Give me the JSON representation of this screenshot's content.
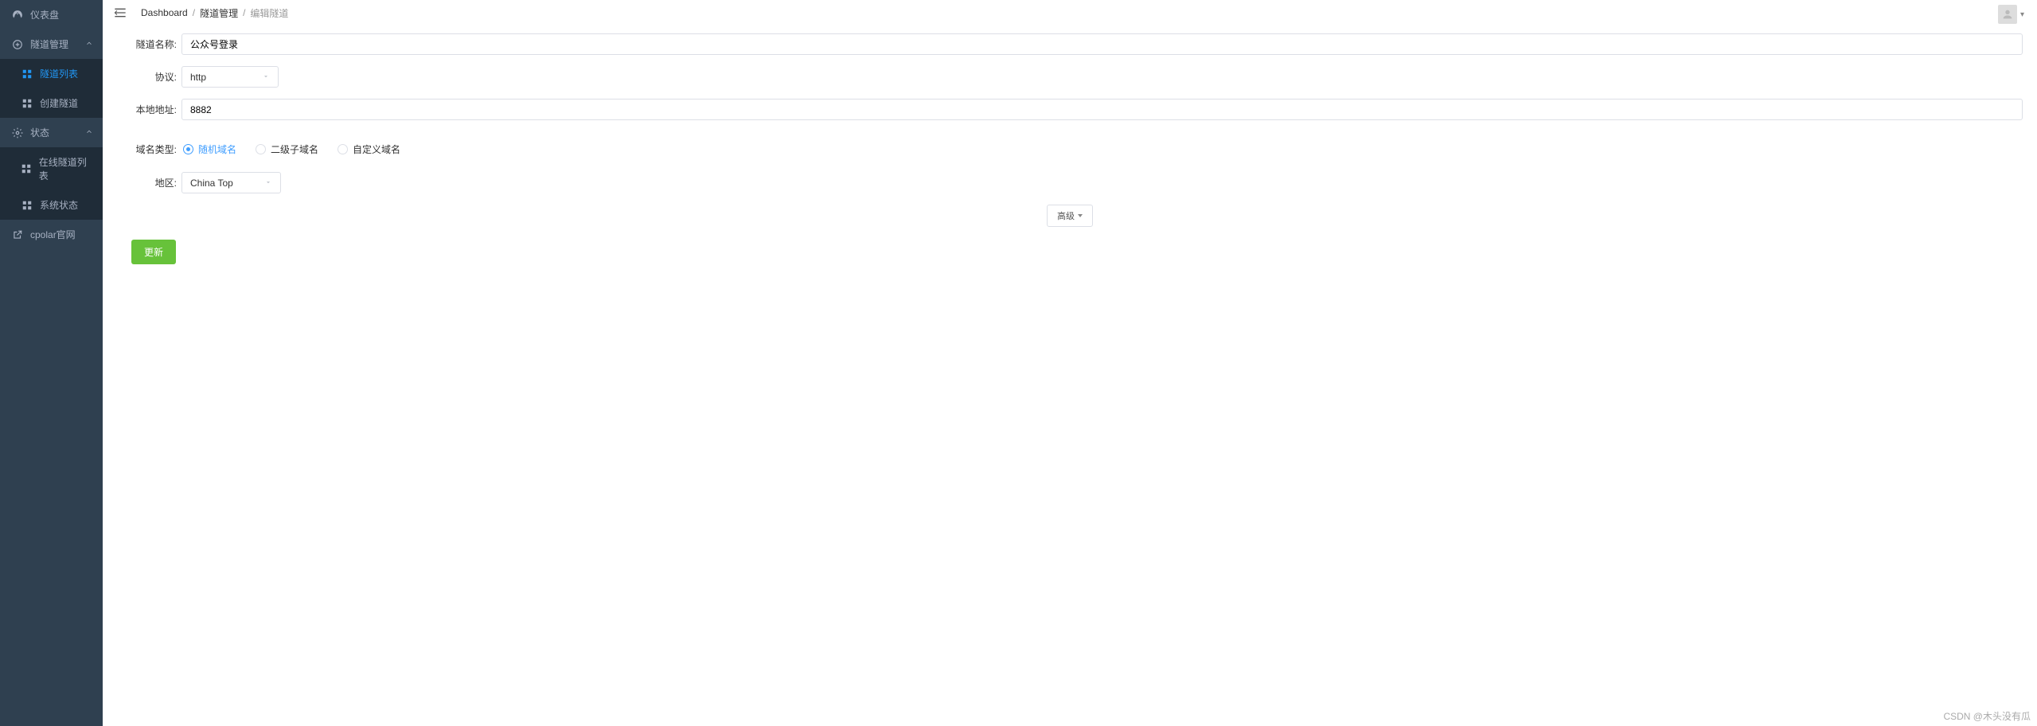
{
  "sidebar": {
    "items": [
      {
        "label": "仪表盘",
        "icon": "dashboard"
      },
      {
        "label": "隧道管理",
        "icon": "plus-circle",
        "expand": true
      },
      {
        "label": "隧道列表",
        "icon": "grid",
        "child": true,
        "active": true
      },
      {
        "label": "创建隧道",
        "icon": "grid",
        "child": true
      },
      {
        "label": "状态",
        "icon": "gear",
        "expand": true
      },
      {
        "label": "在线隧道列表",
        "icon": "grid",
        "child": true
      },
      {
        "label": "系统状态",
        "icon": "grid",
        "child": true
      },
      {
        "label": "cpolar官网",
        "icon": "external"
      }
    ]
  },
  "breadcrumb": {
    "items": [
      "Dashboard",
      "隧道管理",
      "编辑隧道"
    ]
  },
  "form": {
    "tunnel_name": {
      "label": "隧道名称:",
      "value": "公众号登录"
    },
    "protocol": {
      "label": "协议:",
      "value": "http"
    },
    "local_addr": {
      "label": "本地地址:",
      "value": "8882"
    },
    "domain_type": {
      "label": "域名类型:",
      "options": [
        "随机域名",
        "二级子域名",
        "自定义域名"
      ],
      "selected": 0
    },
    "region": {
      "label": "地区:",
      "value": "China Top"
    },
    "advanced_label": "高级",
    "submit_label": "更新"
  },
  "watermark": "CSDN @木头没有瓜"
}
